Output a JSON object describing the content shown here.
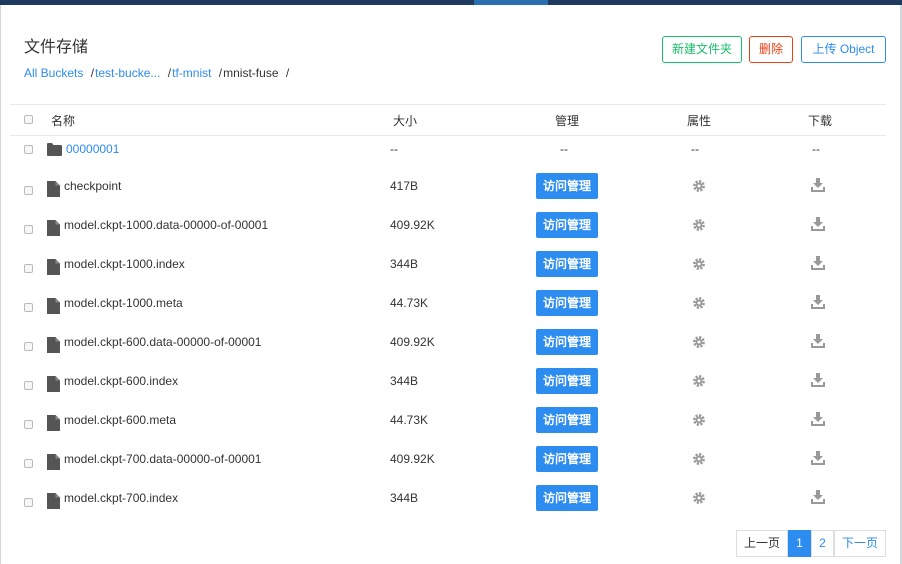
{
  "header": {
    "title": "文件存储",
    "breadcrumbs": [
      {
        "label": "All Buckets",
        "link": true
      },
      {
        "label": "test-bucke...",
        "link": true
      },
      {
        "label": "tf-mnist",
        "link": true
      },
      {
        "label": "mnist-fuse",
        "link": false
      }
    ],
    "buttons": {
      "new_folder": "新建文件夹",
      "delete": "删除",
      "upload": "上传 Object"
    }
  },
  "table": {
    "columns": {
      "name": "名称",
      "size": "大小",
      "manage": "管理",
      "props": "属性",
      "download": "下载"
    },
    "folder": {
      "name": "00000001",
      "size": "--",
      "manage": "--",
      "props": "--",
      "download": "--"
    },
    "manage_label": "访问管理",
    "files": [
      {
        "name": "checkpoint",
        "size": "417B"
      },
      {
        "name": "model.ckpt-1000.data-00000-of-00001",
        "size": "409.92K"
      },
      {
        "name": "model.ckpt-1000.index",
        "size": "344B"
      },
      {
        "name": "model.ckpt-1000.meta",
        "size": "44.73K"
      },
      {
        "name": "model.ckpt-600.data-00000-of-00001",
        "size": "409.92K"
      },
      {
        "name": "model.ckpt-600.index",
        "size": "344B"
      },
      {
        "name": "model.ckpt-600.meta",
        "size": "44.73K"
      },
      {
        "name": "model.ckpt-700.data-00000-of-00001",
        "size": "409.92K"
      },
      {
        "name": "model.ckpt-700.index",
        "size": "344B"
      }
    ]
  },
  "pagination": {
    "prev": "上一页",
    "pages": [
      "1",
      "2"
    ],
    "current": "1",
    "next": "下一页"
  },
  "colors": {
    "primary": "#2d8cf0",
    "success": "#19be6b",
    "danger": "#ed3f14",
    "icon_gray": "#999999",
    "file_icon": "#555555"
  }
}
